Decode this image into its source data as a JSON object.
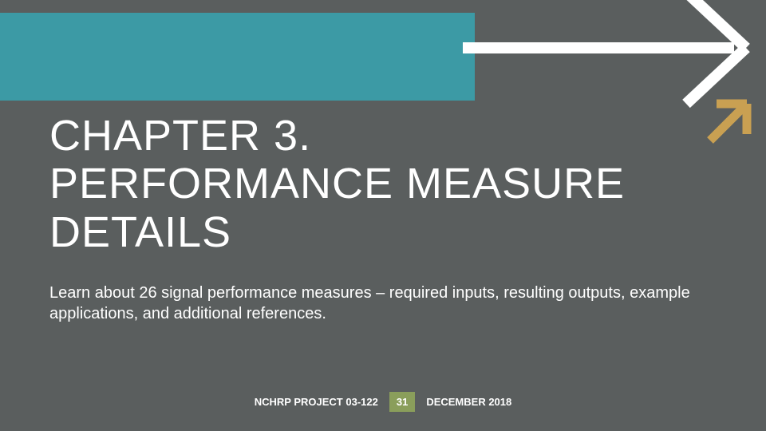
{
  "title": "CHAPTER 3.\nPERFORMANCE MEASURE DETAILS",
  "subtitle": "Learn about 26 signal performance measures – required inputs, resulting outputs, example applications, and additional references.",
  "footer": {
    "project": "NCHRP PROJECT 03-122",
    "page": "31",
    "date": "DECEMBER 2018"
  },
  "colors": {
    "background": "#5a5e5e",
    "teal": "#3c9aa5",
    "gold": "#c9a052",
    "badge": "#8a9e5b",
    "white": "#ffffff"
  }
}
